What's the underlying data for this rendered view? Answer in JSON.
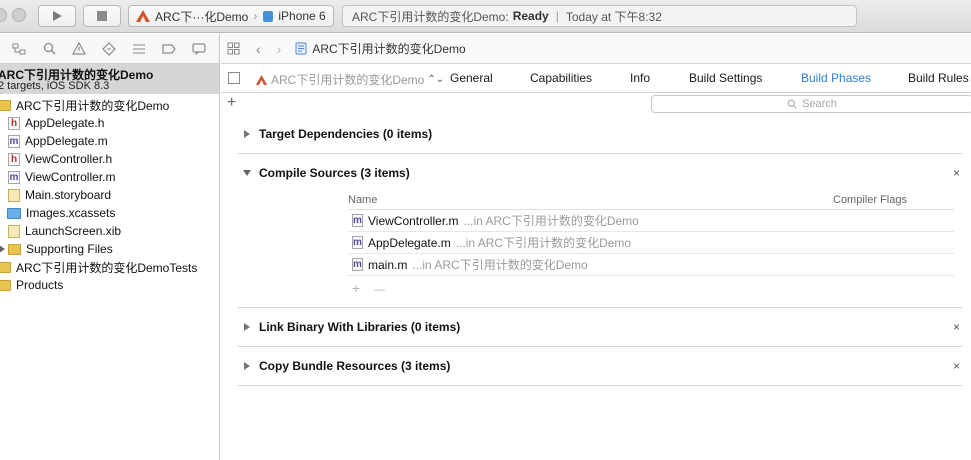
{
  "toolbar": {
    "scheme_target": "ARC下···化Demo",
    "scheme_device": "iPhone 6",
    "status_project": "ARC下引用计数的变化Demo:",
    "status_state": "Ready",
    "status_sep": "|",
    "status_time": "Today at 下午8:32"
  },
  "navigator": {
    "project_title": "ARC下引用计数的变化Demo",
    "project_subtitle": "2 targets, iOS SDK 8.3",
    "items": [
      {
        "label": "ARC下引用计数的变化Demo"
      },
      {
        "label": "AppDelegate.h",
        "badge": "h"
      },
      {
        "label": "AppDelegate.m",
        "badge": "m"
      },
      {
        "label": "ViewController.h",
        "badge": "h"
      },
      {
        "label": "ViewController.m",
        "badge": "m"
      },
      {
        "label": "Main.storyboard"
      },
      {
        "label": "Images.xcassets"
      },
      {
        "label": "LaunchScreen.xib"
      },
      {
        "label": "Supporting Files"
      },
      {
        "label": "ARC下引用计数的变化DemoTests"
      },
      {
        "label": "Products"
      }
    ]
  },
  "jumpbar": {
    "breadcrumb": "ARC下引用计数的变化Demo"
  },
  "tabs": {
    "target": "ARC下引用计数的变化Demo",
    "general": "General",
    "capabilities": "Capabilities",
    "info": "Info",
    "build_settings": "Build Settings",
    "build_phases": "Build Phases",
    "build_rules": "Build Rules"
  },
  "filter": {
    "add": "+",
    "search_placeholder": "Search"
  },
  "phases": {
    "target_dependencies": "Target Dependencies (0 items)",
    "compile_sources": "Compile Sources (3 items)",
    "link_binary": "Link Binary With Libraries (0 items)",
    "copy_bundle": "Copy Bundle Resources (3 items)",
    "close": "×"
  },
  "compile_table": {
    "col_name": "Name",
    "col_flags": "Compiler Flags",
    "rows": [
      {
        "file": "ViewController.m",
        "path": "...in ARC下引用计数的变化Demo",
        "badge": "m"
      },
      {
        "file": "AppDelegate.m",
        "path": "...in ARC下引用计数的变化Demo",
        "badge": "m"
      },
      {
        "file": "main.m",
        "path": "...in ARC下引用计数的变化Demo",
        "badge": "m"
      }
    ],
    "add": "+",
    "remove": "—"
  }
}
